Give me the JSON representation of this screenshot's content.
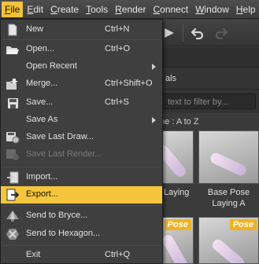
{
  "menubar": {
    "items": [
      {
        "label": "File",
        "underline": "F",
        "rest": "ile"
      },
      {
        "label": "Edit",
        "underline": "E",
        "rest": "dit"
      },
      {
        "label": "Create",
        "underline": "C",
        "rest": "reate"
      },
      {
        "label": "Tools",
        "underline": "T",
        "rest": "ools"
      },
      {
        "label": "Render",
        "underline": "R",
        "rest": "ender"
      },
      {
        "label": "Connect",
        "underline": "C",
        "rest": "onnect"
      },
      {
        "label": "Window",
        "underline": "W",
        "rest": "indow"
      },
      {
        "label": "Help",
        "underline": "H",
        "rest": "elp"
      }
    ]
  },
  "file_menu": {
    "items": [
      {
        "label": "New",
        "shortcut": "Ctrl+N",
        "icon": "new-document-icon"
      },
      {
        "label": "Open...",
        "shortcut": "Ctrl+O",
        "icon": "open-folder-icon"
      },
      {
        "label": "Open Recent",
        "shortcut": "",
        "submenu": true
      },
      {
        "label": "Merge...",
        "shortcut": "Ctrl+Shift+O",
        "icon": "merge-icon"
      },
      {
        "label": "Save...",
        "shortcut": "Ctrl+S",
        "icon": "save-icon"
      },
      {
        "label": "Save As",
        "shortcut": "",
        "submenu": true
      },
      {
        "label": "Save Last Draw...",
        "shortcut": "",
        "icon": "save-draw-icon"
      },
      {
        "label": "Save Last Render...",
        "shortcut": "",
        "disabled": true,
        "icon": "save-render-icon"
      },
      {
        "label": "Import...",
        "shortcut": "",
        "icon": "import-icon"
      },
      {
        "label": "Export...",
        "shortcut": "",
        "highlighted": true,
        "icon": "export-icon"
      },
      {
        "label": "Send to Bryce...",
        "shortcut": "",
        "icon": "bryce-icon"
      },
      {
        "label": "Send to Hexagon...",
        "shortcut": "",
        "icon": "hexagon-icon"
      },
      {
        "label": "Exit",
        "shortcut": "Ctrl+Q"
      }
    ]
  },
  "content_panel": {
    "tab_fragment": "als",
    "filter_placeholder": "text to filter by...",
    "sort_fragment": "me : A to Z",
    "thumbnails": [
      {
        "label": "Laying",
        "pose_tag": ""
      },
      {
        "label": "Base Pose Laying A",
        "pose_tag": ""
      },
      {
        "label": "",
        "pose_tag": "Pose"
      },
      {
        "label": "",
        "pose_tag": "Pose"
      }
    ]
  },
  "colors": {
    "accent": "#f5c63c",
    "menu_bg": "#3f3f3f",
    "pose_tag": "#f2b21d"
  }
}
